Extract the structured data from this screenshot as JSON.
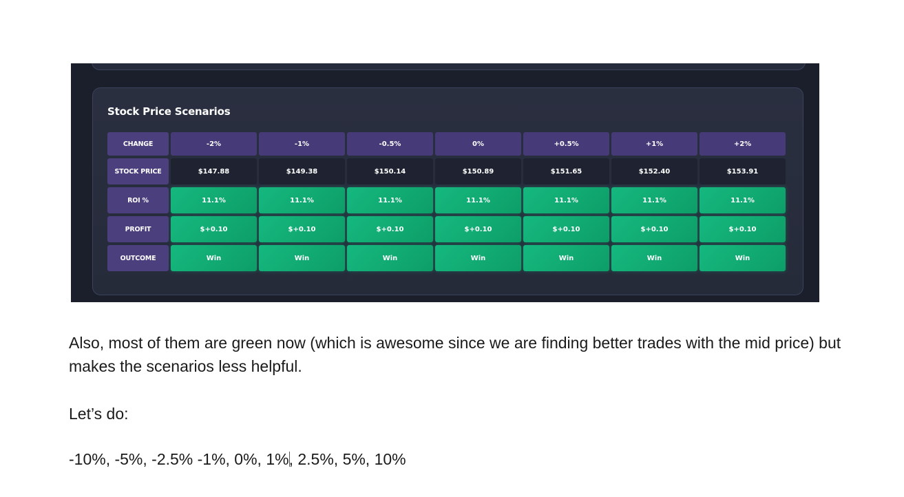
{
  "screenshot": {
    "card_title": "Stock Price Scenarios",
    "row_labels": {
      "change": "CHANGE",
      "stock_price": "STOCK PRICE",
      "roi": "ROI %",
      "profit": "PROFIT",
      "outcome": "OUTCOME"
    },
    "columns": [
      {
        "change": "-2%",
        "stock_price": "$147.88",
        "roi": "11.1%",
        "profit": "$+0.10",
        "outcome": "Win"
      },
      {
        "change": "-1%",
        "stock_price": "$149.38",
        "roi": "11.1%",
        "profit": "$+0.10",
        "outcome": "Win"
      },
      {
        "change": "-0.5%",
        "stock_price": "$150.14",
        "roi": "11.1%",
        "profit": "$+0.10",
        "outcome": "Win"
      },
      {
        "change": "0%",
        "stock_price": "$150.89",
        "roi": "11.1%",
        "profit": "$+0.10",
        "outcome": "Win"
      },
      {
        "change": "+0.5%",
        "stock_price": "$151.65",
        "roi": "11.1%",
        "profit": "$+0.10",
        "outcome": "Win"
      },
      {
        "change": "+1%",
        "stock_price": "$152.40",
        "roi": "11.1%",
        "profit": "$+0.10",
        "outcome": "Win"
      },
      {
        "change": "+2%",
        "stock_price": "$153.91",
        "roi": "11.1%",
        "profit": "$+0.10",
        "outcome": "Win"
      }
    ],
    "colors": {
      "background": "#1b1f2c",
      "card": "#2a2f40",
      "header_cell": "#463b78",
      "price_cell": "#1e2231",
      "win_cell": "#15b87f"
    }
  },
  "document": {
    "paragraph_1": "Also, most of them are green now (which is awesome since we are finding better trades with the mid price) but makes the scenarios less helpful.",
    "paragraph_2": "Let’s do:",
    "paragraph_3_before_cursor": "-10%, -5%, -2.5% -1%, 0%, 1%",
    "paragraph_3_after_cursor": ", 2.5%, 5%, 10%"
  }
}
